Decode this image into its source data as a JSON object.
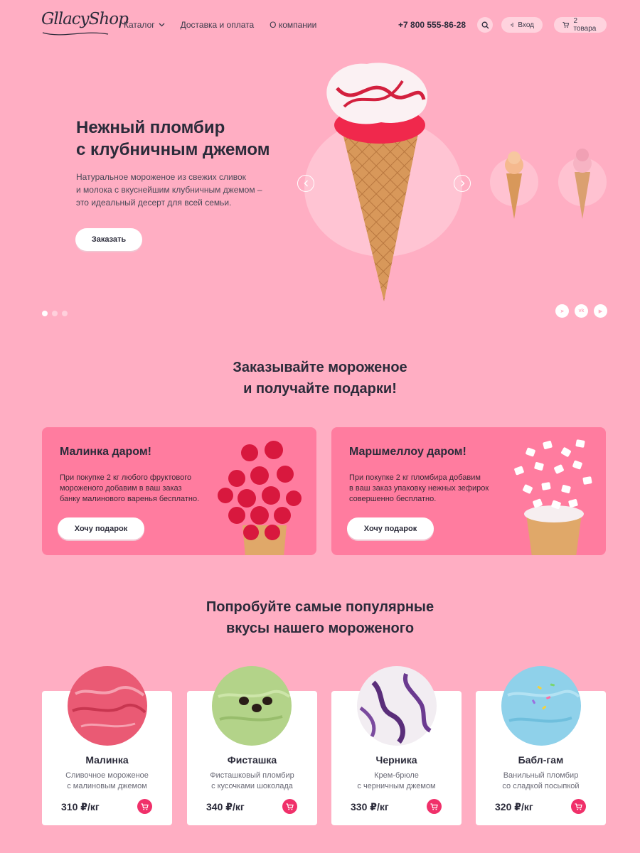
{
  "header": {
    "logo": "GllacyShop",
    "nav": [
      {
        "label": "Каталог",
        "has_dropdown": true
      },
      {
        "label": "Доставка и оплата"
      },
      {
        "label": "О компании"
      }
    ],
    "phone": "+7 800 555-86-28",
    "login_label": "Вход",
    "cart_label": "2 товара"
  },
  "hero": {
    "title_lines": [
      "Нежный пломбир",
      "с клубничным джемом"
    ],
    "description_lines": [
      "Натуральное мороженое из свежих сливок",
      "и молока с вкуснейшим клубничным джемом –",
      "это идеальный десерт для всей семьи."
    ],
    "order_button": "Заказать",
    "slides_count": 3,
    "active_slide": 1,
    "social": [
      {
        "icon": "telegram-icon",
        "glyph": "➤"
      },
      {
        "icon": "vk-icon",
        "glyph": "vk"
      },
      {
        "icon": "youtube-icon",
        "glyph": "▶"
      }
    ]
  },
  "gifts": {
    "title_lines": [
      "Заказывайте мороженое",
      "и получайте подарки!"
    ],
    "cards": [
      {
        "title": "Малинка даром!",
        "text_lines": [
          "При покупке 2 кг любого фруктового",
          "мороженого добавим в ваш заказ",
          "банку малинового варенья бесплатно."
        ],
        "button": "Хочу подарок"
      },
      {
        "title": "Маршмеллоу даром!",
        "text_lines": [
          "При покупке 2 кг пломбира добавим",
          "в ваш заказ упаковку нежных зефирок",
          "совершенно бесплатно."
        ],
        "button": "Хочу подарок"
      }
    ]
  },
  "flavors": {
    "title_lines": [
      "Попробуйте самые популярные",
      "вкусы нашего мороженого"
    ],
    "products": [
      {
        "name": "Малинка",
        "desc_lines": [
          "Сливочное мороженое",
          "с малиновым джемом"
        ],
        "price": "310 ₽/кг",
        "color": "#f0607a"
      },
      {
        "name": "Фисташка",
        "desc_lines": [
          "Фисташковый пломбир",
          "с кусочками шоколада"
        ],
        "price": "340 ₽/кг",
        "color": "#b3d389"
      },
      {
        "name": "Черника",
        "desc_lines": [
          "Крем-брюле",
          "с черничным джемом"
        ],
        "price": "330 ₽/кг",
        "color": "#f2edf2"
      },
      {
        "name": "Бабл-гам",
        "desc_lines": [
          "Ванильный пломбир",
          "со сладкой посыпкой"
        ],
        "price": "320 ₽/кг",
        "color": "#8fd1ea"
      }
    ]
  },
  "colors": {
    "background": "#ffaec3",
    "promo_card": "#ff7c9f",
    "accent": "#f0306a"
  }
}
